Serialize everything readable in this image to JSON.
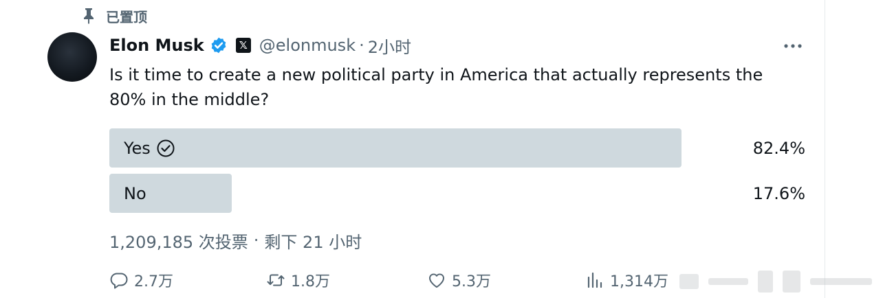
{
  "pinned": {
    "label": "已置顶",
    "icon": "pin-icon"
  },
  "author": {
    "name": "Elon Musk",
    "handle": "@elonmusk",
    "time": "2小时",
    "separator": "·",
    "verified_icon": "verified-badge-icon",
    "org_badge": "𝕏"
  },
  "tweet": {
    "text": "Is it time to create a new political party in America that actually represents the 80% in the middle?"
  },
  "poll": {
    "options": [
      {
        "label": "Yes",
        "percent": "82.4%",
        "fraction": 0.824,
        "selected": true
      },
      {
        "label": "No",
        "percent": "17.6%",
        "fraction": 0.176,
        "selected": false
      }
    ],
    "votes": "1,209,185 次投票",
    "remaining": "剩下 21 小时",
    "separator": "·"
  },
  "actions": {
    "replies": "2.7万",
    "retweets": "1.8万",
    "likes": "5.3万",
    "views": "1,314万"
  },
  "colors": {
    "bar": "#cfd9de",
    "secondary_text": "#536471",
    "verified": "#1d9bf0",
    "text": "#0f1419"
  }
}
